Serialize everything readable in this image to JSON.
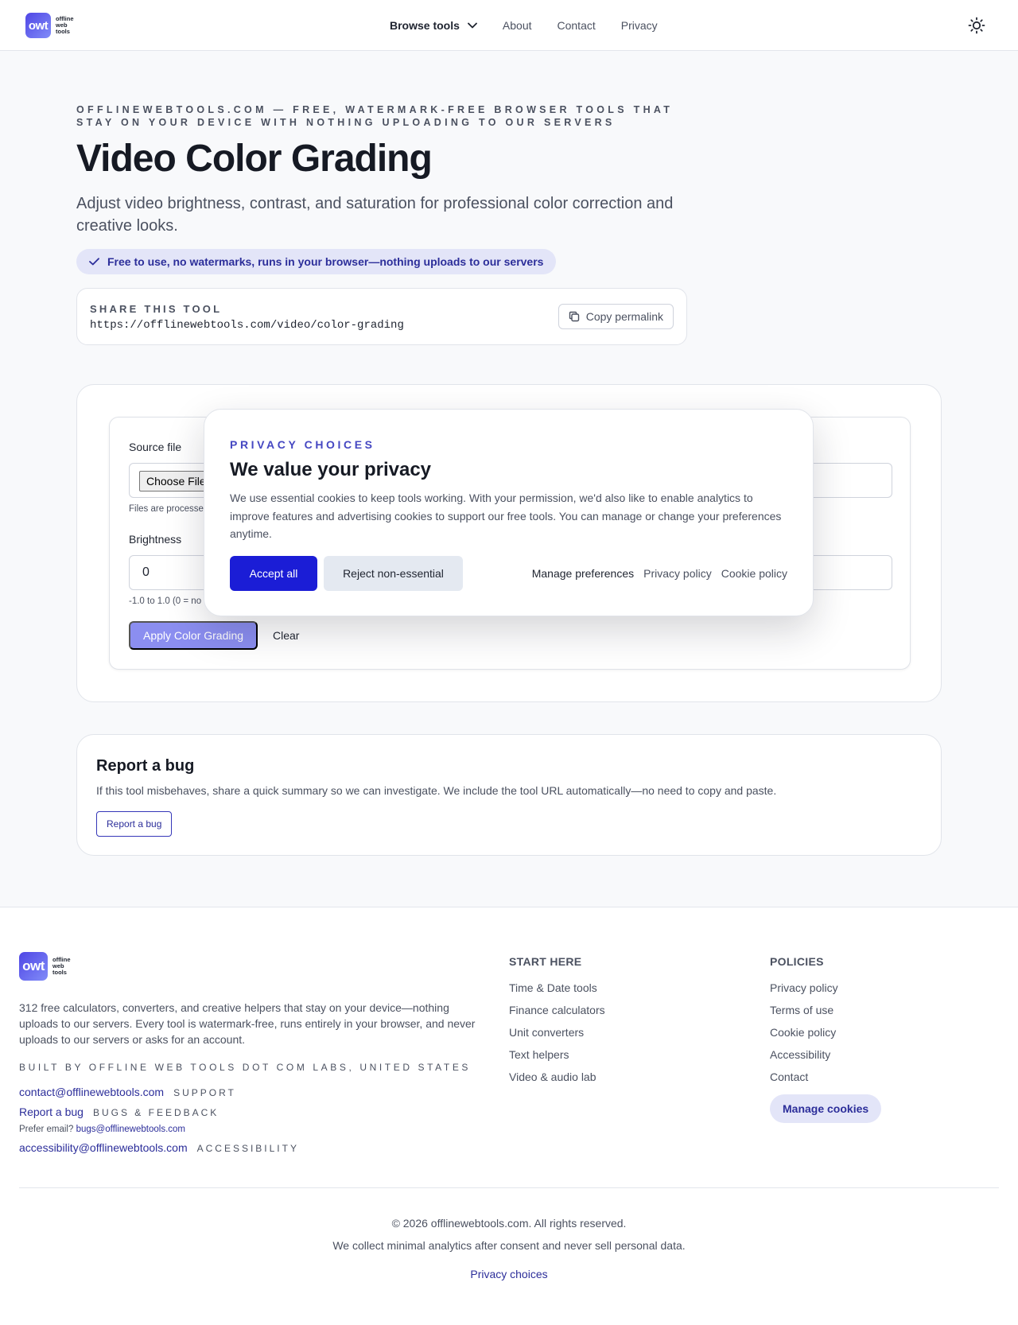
{
  "header": {
    "logo_mark": "owt",
    "logo_lines": [
      "offline",
      "web",
      "tools"
    ],
    "nav": {
      "browse": "Browse tools",
      "about": "About",
      "contact": "Contact",
      "privacy": "Privacy"
    }
  },
  "hero": {
    "eyebrow": "OFFLINEWEBTOOLS.COM — FREE, WATERMARK-FREE BROWSER TOOLS THAT STAY ON YOUR DEVICE WITH NOTHING UPLOADING TO OUR SERVERS",
    "title": "Video Color Grading",
    "lede": "Adjust video brightness, contrast, and saturation for professional color correction and creative looks.",
    "badge": "Free to use, no watermarks, runs in your browser—nothing uploads to our servers"
  },
  "share": {
    "label": "SHARE THIS TOOL",
    "url": "https://offlinewebtools.com/video/color-grading",
    "copy_label": "Copy permalink"
  },
  "tool": {
    "source_label": "Source file",
    "choose_file": "Choose File",
    "file_hint": "Files are processe",
    "brightness_label": "Brightness",
    "brightness_value": "0",
    "brightness_hint": "-1.0 to 1.0 (0 = no",
    "apply_label": "Apply Color Grading",
    "clear_label": "Clear"
  },
  "consent": {
    "eyebrow": "PRIVACY CHOICES",
    "title": "We value your privacy",
    "body": "We use essential cookies to keep tools working. With your permission, we'd also like to enable analytics to improve features and advertising cookies to support our free tools. You can manage or change your preferences anytime.",
    "accept": "Accept all",
    "reject": "Reject non-essential",
    "manage": "Manage preferences",
    "privacy_policy": "Privacy policy",
    "cookie_policy": "Cookie policy"
  },
  "bug": {
    "title": "Report a bug",
    "text": "If this tool misbehaves, share a quick summary so we can investigate. We include the tool URL automatically—no need to copy and paste.",
    "button": "Report a bug"
  },
  "footer": {
    "description": "312 free calculators, converters, and creative helpers that stay on your device—nothing uploads to our servers. Every tool is watermark-free, runs entirely in your browser, and never uploads to our servers or asks for an account.",
    "built_by": "BUILT BY OFFLINE WEB TOOLS DOT COM LABS, UNITED STATES",
    "contacts": [
      {
        "link": "contact@offlinewebtools.com",
        "tag": "SUPPORT"
      },
      {
        "link": "Report a bug",
        "tag": "BUGS & FEEDBACK"
      },
      {
        "link": "accessibility@offlinewebtools.com",
        "tag": "ACCESSIBILITY"
      }
    ],
    "prefer_email_label": "Prefer email?",
    "prefer_email_link": "bugs@offlinewebtools.com",
    "start_here": {
      "heading": "START HERE",
      "items": [
        "Time & Date tools",
        "Finance calculators",
        "Unit converters",
        "Text helpers",
        "Video & audio lab"
      ]
    },
    "policies": {
      "heading": "POLICIES",
      "items": [
        "Privacy policy",
        "Terms of use",
        "Cookie policy",
        "Accessibility",
        "Contact"
      ]
    },
    "manage_cookies": "Manage cookies",
    "copyright": "© 2026 offlinewebtools.com. All rights reserved.",
    "analytics_note": "We collect minimal analytics after consent and never sell personal data.",
    "privacy_choices": "Privacy choices"
  }
}
